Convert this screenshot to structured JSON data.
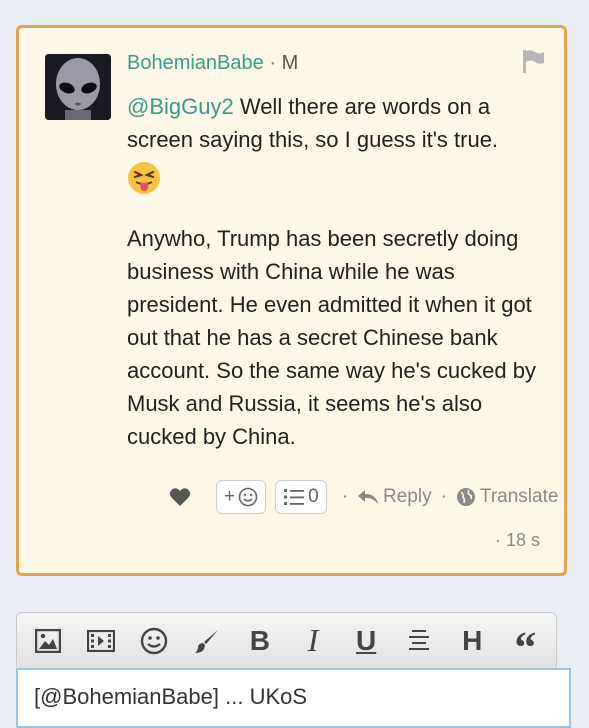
{
  "comment": {
    "author": "BohemianBabe",
    "separator": "·",
    "badge": "M",
    "mention": "@BigGuy2",
    "first_text": " Well there are words on a screen saying this, so I guess it's true.",
    "emoji": "😝",
    "paragraph": "Anywho, Trump has been secretly doing business with China while he was president. He even admitted it when it got out that he has a secret Chinese bank account. So the same way he's cucked by Musk and Russia, it seems he's also cucked by China.",
    "timestamp": "· 18 s"
  },
  "actions": {
    "add_reaction": "+",
    "list_count": "0",
    "dot1": "·",
    "reply": "Reply",
    "dot2": "·",
    "translate": "Translate"
  },
  "toolbar": {
    "bold": "B",
    "italic": "I",
    "underline": "U",
    "heading": "H",
    "quote": "“"
  },
  "editor": {
    "text": "[@BohemianBabe] ... UKoS"
  },
  "colors": {
    "accent": "#3d9a8f",
    "card_border": "#e9a24a",
    "card_bg": "#fdf8e8"
  }
}
